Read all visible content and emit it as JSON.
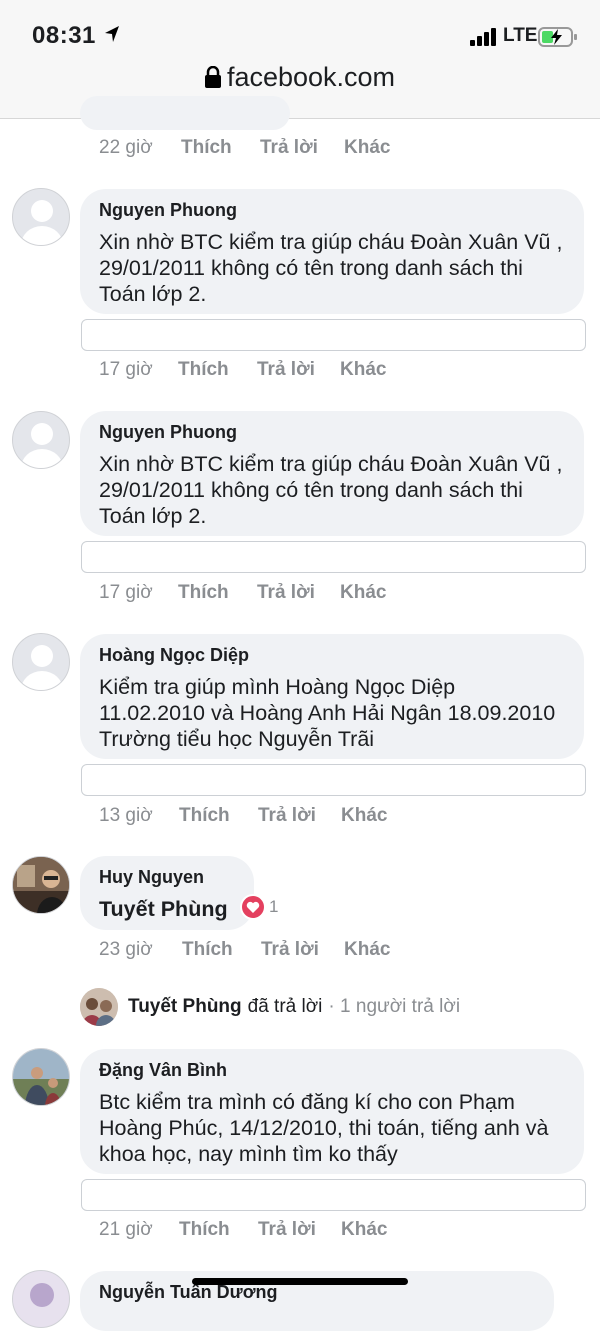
{
  "status_bar": {
    "time": "08:31",
    "network": "LTE"
  },
  "browser": {
    "url": "facebook.com"
  },
  "actions": {
    "like": "Thích",
    "reply": "Trả lời",
    "more": "Khác"
  },
  "first_meta": {
    "time": "22 giờ"
  },
  "comments": [
    {
      "author": "Nguyen Phuong",
      "text": "Xin nhờ BTC kiểm tra giúp cháu Đoàn Xuân Vũ , 29/01/2011 không có tên trong danh sách thi Toán lớp 2.",
      "time": "17 giờ"
    },
    {
      "author": "Nguyen Phuong",
      "text": "Xin nhờ BTC kiểm tra giúp cháu Đoàn Xuân Vũ , 29/01/2011 không có tên trong danh sách thi Toán lớp 2.",
      "time": "17 giờ"
    },
    {
      "author": "Hoàng Ngọc Diệp",
      "text": "Kiểm tra giúp mình Hoàng Ngọc Diệp 11.02.2010 và Hoàng Anh Hải Ngân 18.09.2010 Trường tiểu học Nguyễn Trãi",
      "time": "13 giờ"
    },
    {
      "author": "Huy Nguyen",
      "text": "Tuyết Phùng",
      "time": "23 giờ",
      "reaction_count": "1",
      "replies": {
        "name": "Tuyết Phùng",
        "action": "đã trả lời",
        "count": "· 1 người trả lời"
      }
    },
    {
      "author": "Đặng Vân Bình",
      "text": "Btc kiểm tra mình có đăng kí cho con Phạm Hoàng Phúc, 14/12/2010, thi toán, tiếng anh và khoa học, nay mình tìm ko thấy",
      "time": "21 giờ"
    },
    {
      "author": "Nguyễn Tuấn Dương"
    }
  ]
}
